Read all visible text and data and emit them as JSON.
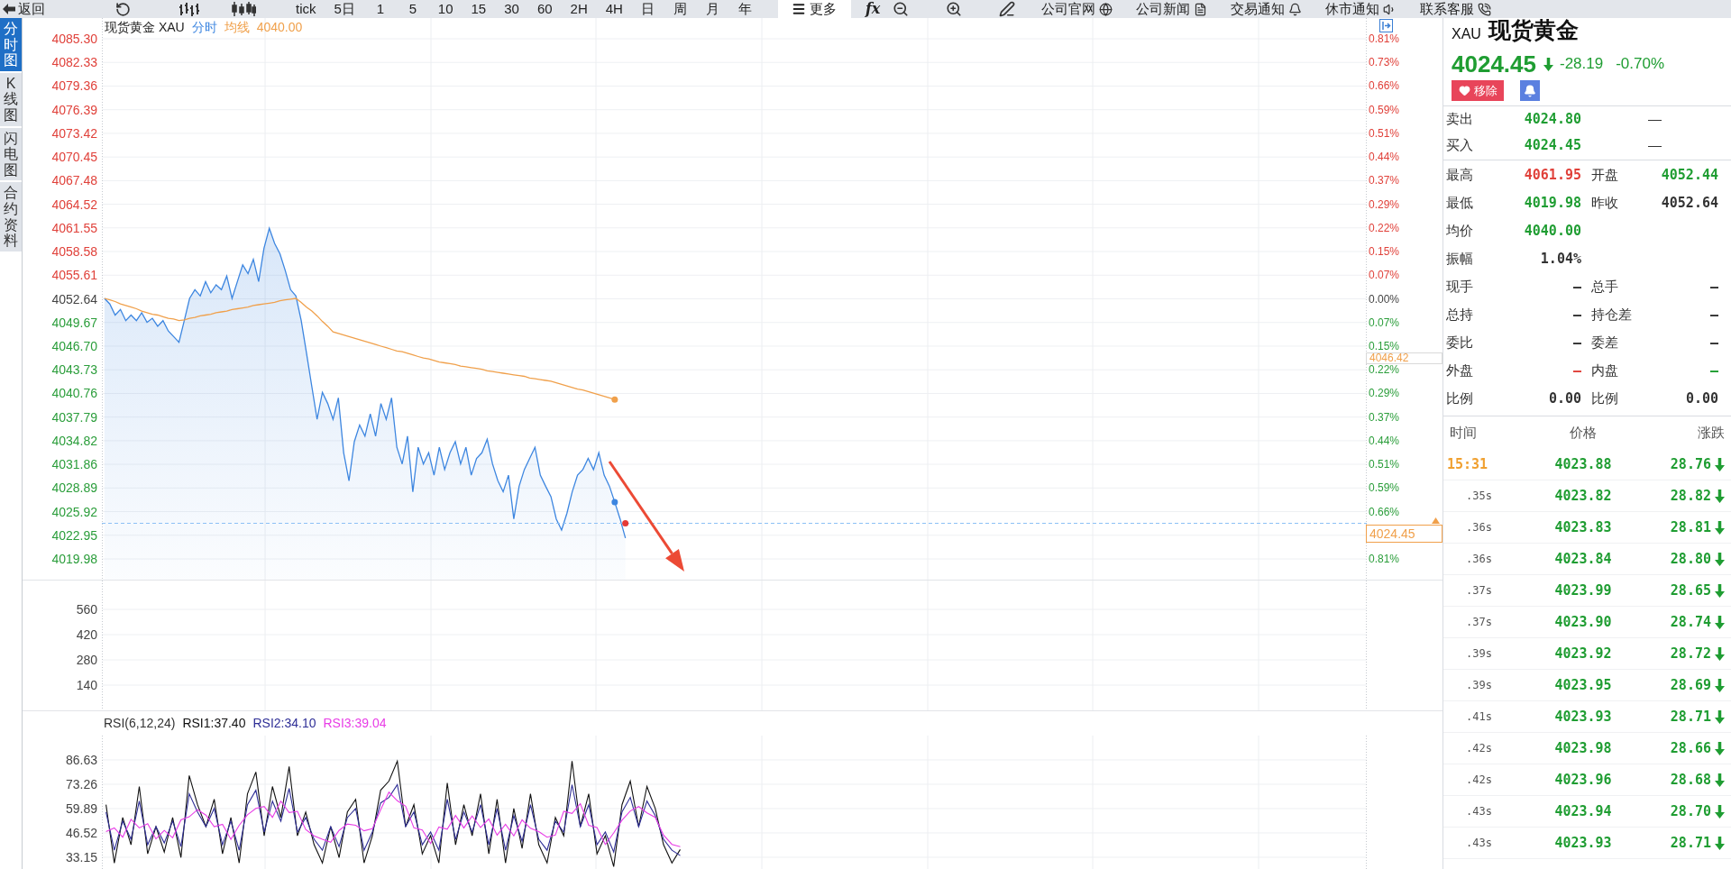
{
  "toolbar": {
    "back": "返回",
    "periods": [
      "tick",
      "5日",
      "1",
      "5",
      "10",
      "15",
      "30",
      "60",
      "2H",
      "4H",
      "日",
      "周",
      "月",
      "年"
    ],
    "more": "更多",
    "formula": "fx",
    "links": [
      "公司官网",
      "公司新闻",
      "交易通知",
      "休市通知",
      "联系客服"
    ]
  },
  "view_tabs": [
    {
      "label": "分时图",
      "selected": true
    },
    {
      "label": "K线图",
      "selected": false
    },
    {
      "label": "闪电图",
      "selected": false
    },
    {
      "label": "合约资料",
      "selected": false
    }
  ],
  "price_chart": {
    "title": "现货黄金 XAU",
    "legend_value": "4040.00",
    "chart_data": {
      "type": "line",
      "grid": true,
      "ylim": [
        4019.98,
        4085.3
      ],
      "yticks": [
        {
          "value": 4085.3,
          "label": "4085.30"
        },
        {
          "value": 4082.33,
          "label": "4082.33"
        },
        {
          "value": 4079.36,
          "label": "4079.36"
        },
        {
          "value": 4076.39,
          "label": "4076.39"
        },
        {
          "value": 4073.42,
          "label": "4073.42"
        },
        {
          "value": 4070.45,
          "label": "4070.45"
        },
        {
          "value": 4067.48,
          "label": "4067.48"
        },
        {
          "value": 4064.52,
          "label": "4064.52"
        },
        {
          "value": 4061.55,
          "label": "4061.55"
        },
        {
          "value": 4058.58,
          "label": "4058.58"
        },
        {
          "value": 4055.61,
          "label": "4055.61"
        },
        {
          "value": 4052.64,
          "label": "4052.64"
        },
        {
          "value": 4049.67,
          "label": "4049.67"
        },
        {
          "value": 4046.7,
          "label": "4046.70"
        },
        {
          "value": 4043.73,
          "label": "4043.73"
        },
        {
          "value": 4040.76,
          "label": "4040.76"
        },
        {
          "value": 4037.79,
          "label": "4037.79"
        },
        {
          "value": 4034.82,
          "label": "4034.82"
        },
        {
          "value": 4031.86,
          "label": "4031.86"
        },
        {
          "value": 4028.89,
          "label": "4028.89"
        },
        {
          "value": 4025.92,
          "label": "4025.92"
        },
        {
          "value": 4022.95,
          "label": "4022.95"
        },
        {
          "value": 4019.98,
          "label": "4019.98"
        }
      ],
      "series": [
        {
          "name": "分时",
          "color": "#3d86e0",
          "values": [
            4052.7,
            4052.0,
            4050.6,
            4051.3,
            4049.9,
            4050.6,
            4049.9,
            4050.9,
            4049.7,
            4050.2,
            4049.2,
            4049.9,
            4048.6,
            4047.9,
            4047.2,
            4049.9,
            4052.7,
            4053.8,
            4053.0,
            4054.8,
            4053.4,
            4054.4,
            4053.8,
            4055.5,
            4052.7,
            4054.8,
            4056.9,
            4055.8,
            4057.6,
            4054.8,
            4059.0,
            4061.5,
            4059.6,
            4058.3,
            4056.2,
            4053.8,
            4053.0,
            4049.9,
            4045.8,
            4041.6,
            4037.5,
            4040.9,
            4039.5,
            4037.5,
            4040.2,
            4033.3,
            4029.8,
            4034.7,
            4036.8,
            4035.4,
            4038.2,
            4035.4,
            4039.5,
            4037.5,
            4040.2,
            4034.0,
            4031.9,
            4035.4,
            4028.4,
            4034.0,
            4031.9,
            4033.3,
            4030.5,
            4034.0,
            4031.2,
            4033.3,
            4034.7,
            4031.9,
            4034.0,
            4030.5,
            4032.6,
            4033.3,
            4035.0,
            4031.9,
            4029.8,
            4028.4,
            4030.5,
            4025.0,
            4029.1,
            4031.2,
            4032.6,
            4034.0,
            4030.5,
            4029.1,
            4027.8,
            4025.0,
            4023.6,
            4025.7,
            4028.4,
            4030.5,
            4031.2,
            4032.6,
            4031.2,
            4033.3,
            4030.5,
            4029.1,
            4027.1,
            4025.0,
            4022.6,
            null,
            null,
            null,
            null,
            null,
            null,
            null,
            null,
            null,
            null,
            null,
            null,
            null,
            null,
            null,
            null,
            null,
            null,
            null,
            null,
            null,
            null,
            null,
            null,
            null,
            null,
            null,
            null,
            null,
            null,
            null,
            null,
            null,
            null,
            null,
            null,
            null,
            null,
            null,
            null,
            null,
            null,
            null,
            null,
            null,
            null,
            null,
            null,
            null,
            null,
            null,
            null,
            null,
            null,
            null,
            null,
            null,
            null,
            null,
            null,
            null,
            null,
            null,
            null,
            null,
            null,
            null,
            null,
            null,
            null,
            null,
            null,
            null,
            null,
            null,
            null,
            null,
            null,
            null,
            null,
            null,
            null,
            null,
            null,
            null,
            null,
            null,
            null,
            null,
            null,
            null,
            null,
            null,
            null,
            null,
            null,
            null,
            null,
            null,
            null,
            null,
            null,
            null,
            null,
            null,
            null,
            null,
            null,
            null,
            null,
            null,
            null,
            null,
            null,
            null,
            null,
            null,
            null,
            null,
            null,
            null,
            null,
            null,
            null,
            null,
            null,
            null,
            null,
            null,
            null,
            null,
            null,
            null,
            null,
            null,
            null,
            null,
            null,
            null
          ]
        },
        {
          "name": "均线",
          "color": "#f0a04b",
          "values": [
            4052.7,
            4052.5,
            4052.3,
            4052.0,
            4051.8,
            4051.6,
            4051.4,
            4051.1,
            4050.9,
            4050.7,
            4050.6,
            4050.4,
            4050.2,
            4050.1,
            4049.9,
            4050.0,
            4050.2,
            4050.3,
            4050.5,
            4050.6,
            4050.7,
            4050.9,
            4051.0,
            4051.1,
            4051.3,
            4051.4,
            4051.5,
            4051.6,
            4051.8,
            4051.9,
            4052.0,
            4052.1,
            4052.2,
            4052.4,
            4052.5,
            4052.6,
            4052.7,
            4052.2,
            4051.6,
            4051.1,
            4050.5,
            4049.8,
            4049.2,
            4048.5,
            4048.3,
            4048.1,
            4047.9,
            4047.7,
            4047.5,
            4047.3,
            4047.1,
            4046.9,
            4046.7,
            4046.5,
            4046.3,
            4046.1,
            4046.0,
            4045.8,
            4045.6,
            4045.4,
            4045.2,
            4045.1,
            4044.9,
            4044.7,
            4044.6,
            4044.5,
            4044.4,
            4044.2,
            4044.1,
            4044.0,
            4043.9,
            4043.8,
            4043.6,
            4043.5,
            4043.4,
            4043.3,
            4043.2,
            4043.1,
            4043.0,
            4042.9,
            4042.7,
            4042.6,
            4042.5,
            4042.4,
            4042.3,
            4042.1,
            4041.9,
            4041.7,
            4041.5,
            4041.3,
            4041.2,
            4041.0,
            4040.8,
            4040.6,
            4040.4,
            4040.2,
            4040.0,
            null,
            null,
            null,
            null,
            null,
            null,
            null,
            null,
            null,
            null,
            null,
            null,
            null,
            null,
            null,
            null,
            null,
            null,
            null,
            null,
            null,
            null,
            null,
            null,
            null,
            null,
            null,
            null,
            null,
            null,
            null,
            null,
            null,
            null,
            null,
            null,
            null,
            null,
            null,
            null,
            null,
            null,
            null,
            null,
            null,
            null,
            null,
            null,
            null,
            null,
            null,
            null,
            null,
            null,
            null,
            null,
            null,
            null,
            null,
            null,
            null,
            null,
            null,
            null,
            null,
            null,
            null,
            null,
            null,
            null,
            null,
            null,
            null,
            null,
            null,
            null,
            null,
            null,
            null,
            null,
            null,
            null,
            null,
            null,
            null,
            null,
            null,
            null,
            null,
            null,
            null,
            null,
            null,
            null,
            null,
            null,
            null,
            null,
            null,
            null,
            null,
            null,
            null,
            null,
            null,
            null,
            null,
            null,
            null,
            null,
            null,
            null,
            null,
            null,
            null,
            null,
            null,
            null,
            null,
            null,
            null,
            null,
            null,
            null,
            null,
            null,
            null,
            null,
            null,
            null,
            null,
            null,
            null,
            null,
            null,
            null,
            null,
            null,
            null,
            null,
            null
          ]
        }
      ],
      "ref_lines": [
        {
          "axis": "y",
          "value": 4024.45,
          "label": "4024.45",
          "color": "#8cc0f5"
        }
      ],
      "annotations": [
        "4046.42"
      ]
    },
    "tick_styles": [
      {
        "color": "#e0413a"
      },
      {
        "color": "#e0413a"
      },
      {
        "color": "#e0413a"
      },
      {
        "color": "#e0413a"
      },
      {
        "color": "#e0413a"
      },
      {
        "color": "#e0413a"
      },
      {
        "color": "#e0413a"
      },
      {
        "color": "#e0413a"
      },
      {
        "color": "#e0413a"
      },
      {
        "color": "#e0413a"
      },
      {
        "color": "#e0413a"
      },
      {
        "color": "#444444"
      },
      {
        "color": "#2a9d3a"
      },
      {
        "color": "#2a9d3a"
      },
      {
        "color": "#2a9d3a"
      },
      {
        "color": "#2a9d3a"
      },
      {
        "color": "#2a9d3a"
      },
      {
        "color": "#2a9d3a"
      },
      {
        "color": "#2a9d3a"
      },
      {
        "color": "#2a9d3a"
      },
      {
        "color": "#2a9d3a"
      },
      {
        "color": "#2a9d3a"
      },
      {
        "color": "#2a9d3a"
      }
    ],
    "right_axis": {
      "above_tag": [
        {
          "label": "0.81%",
          "color": "#e0413a"
        },
        {
          "label": "0.73%",
          "color": "#e0413a"
        },
        {
          "label": "0.66%",
          "color": "#e0413a"
        },
        {
          "label": "0.59%",
          "color": "#e0413a"
        },
        {
          "label": "0.51%",
          "color": "#e0413a"
        },
        {
          "label": "0.44%",
          "color": "#e0413a"
        },
        {
          "label": "0.37%",
          "color": "#e0413a"
        },
        {
          "label": "0.29%",
          "color": "#e0413a"
        },
        {
          "label": "0.22%",
          "color": "#e0413a"
        },
        {
          "label": "0.15%",
          "color": "#e0413a"
        },
        {
          "label": "0.07%",
          "color": "#e0413a"
        },
        {
          "label": "0.00%",
          "color": "#444444"
        },
        {
          "label": "0.07%",
          "color": "#2a9d3a"
        },
        {
          "label": "0.15%",
          "color": "#2a9d3a"
        },
        {
          "label": "0.22%",
          "color": "#2a9d3a"
        },
        {
          "label": "0.29%",
          "color": "#2a9d3a"
        },
        {
          "label": "0.37%",
          "color": "#2a9d3a"
        },
        {
          "label": "0.44%",
          "color": "#2a9d3a"
        },
        {
          "label": "0.51%",
          "color": "#2a9d3a"
        },
        {
          "label": "0.59%",
          "color": "#2a9d3a"
        },
        {
          "label": "0.66%",
          "color": "#2a9d3a"
        }
      ],
      "below_tag": [
        {
          "label": "0.81%",
          "color": "#2a9d3a"
        }
      ]
    }
  },
  "volume_chart": {
    "axis_labels": [
      "560",
      "420",
      "280",
      "140"
    ]
  },
  "rsi_chart": {
    "title": "RSI(6,12,24)",
    "chart_data": {
      "type": "line",
      "grid": true,
      "ylim": [
        26.7,
        100
      ],
      "yticks": [
        {
          "value": 86.63,
          "label": "86.63"
        },
        {
          "value": 73.26,
          "label": "73.26"
        },
        {
          "value": 59.89,
          "label": "59.89"
        },
        {
          "value": 46.52,
          "label": "46.52"
        },
        {
          "value": 33.15,
          "label": "33.15"
        }
      ],
      "series": [
        {
          "name": "RSI1:37.40",
          "color": "#111111",
          "values": [
            62,
            30,
            55,
            40,
            72,
            35,
            50,
            36,
            55,
            33,
            78,
            62,
            50,
            65,
            35,
            55,
            30,
            68,
            80,
            45,
            72,
            55,
            83,
            45,
            58,
            40,
            30,
            50,
            33,
            58,
            65,
            30,
            45,
            70,
            75,
            86,
            50,
            62,
            35,
            45,
            30,
            74,
            40,
            62,
            45,
            68,
            35,
            65,
            30,
            60,
            38,
            68,
            40,
            30,
            55,
            45,
            86,
            50,
            68,
            35,
            45,
            28,
            62,
            75,
            50,
            72,
            60,
            40,
            30,
            37.4,
            null,
            null,
            null,
            null,
            null,
            null,
            null,
            null,
            null,
            null,
            null,
            null,
            null,
            null,
            null,
            null,
            null,
            null,
            null,
            null,
            null,
            null,
            null,
            null,
            null,
            null,
            null,
            null,
            null,
            null,
            null,
            null,
            null,
            null,
            null,
            null,
            null,
            null,
            null,
            null,
            null,
            null,
            null,
            null,
            null,
            null,
            null,
            null,
            null,
            null,
            null,
            null,
            null,
            null,
            null,
            null,
            null,
            null,
            null,
            null,
            null,
            null,
            null,
            null,
            null,
            null,
            null,
            null,
            null,
            null,
            null,
            null,
            null,
            null,
            null,
            null,
            null,
            null,
            null,
            null,
            null,
            null
          ]
        },
        {
          "name": "RSI2:34.10",
          "color": "#2e2e96",
          "values": [
            58,
            37,
            53,
            43,
            64,
            40,
            50,
            41,
            53,
            39,
            68,
            58,
            50,
            60,
            40,
            53,
            37,
            62,
            70,
            47,
            64,
            53,
            71,
            47,
            55,
            43,
            37,
            50,
            39,
            55,
            60,
            37,
            47,
            63,
            66,
            73,
            50,
            58,
            40,
            47,
            37,
            65,
            43,
            58,
            47,
            62,
            40,
            60,
            37,
            56,
            42,
            62,
            43,
            37,
            53,
            47,
            73,
            50,
            62,
            40,
            47,
            36,
            58,
            66,
            50,
            64,
            56,
            43,
            37,
            34.1,
            null,
            null,
            null,
            null,
            null,
            null,
            null,
            null,
            null,
            null,
            null,
            null,
            null,
            null,
            null,
            null,
            null,
            null,
            null,
            null,
            null,
            null,
            null,
            null,
            null,
            null,
            null,
            null,
            null,
            null,
            null,
            null,
            null,
            null,
            null,
            null,
            null,
            null,
            null,
            null,
            null,
            null,
            null,
            null,
            null,
            null,
            null,
            null,
            null,
            null,
            null,
            null,
            null,
            null,
            null,
            null,
            null,
            null,
            null,
            null,
            null,
            null,
            null,
            null,
            null,
            null,
            null,
            null,
            null,
            null,
            null,
            null,
            null,
            null,
            null,
            null,
            null,
            null,
            null,
            null,
            null,
            null
          ]
        },
        {
          "name": "RSI3:39.04",
          "color": "#e83de6",
          "values": [
            47.2,
            49.3,
            44.2,
            54,
            49.3,
            51.6,
            43.2,
            47.9,
            43.9,
            53.7,
            55.4,
            59.3,
            56.3,
            50,
            51.2,
            43,
            50.7,
            56.5,
            60,
            61,
            55.1,
            64,
            57.7,
            58.4,
            48.4,
            44.9,
            43,
            41.4,
            47.9,
            51.4,
            50.7,
            47.7,
            48.8,
            59.3,
            68.9,
            64.2,
            61.2,
            49.3,
            48.1,
            40.7,
            49.8,
            48.6,
            56.1,
            49.3,
            55.8,
            49.5,
            54.2,
            45.3,
            51.2,
            44.9,
            53.7,
            49.1,
            47.2,
            44.2,
            45.3,
            58.4,
            57.2,
            62.6,
            50.7,
            49.5,
            40.2,
            46.5,
            53.5,
            58.6,
            61,
            57.5,
            55.1,
            45.3,
            40.2,
            39,
            null,
            null,
            null,
            null,
            null,
            null,
            null,
            null,
            null,
            null,
            null,
            null,
            null,
            null,
            null,
            null,
            null,
            null,
            null,
            null,
            null,
            null,
            null,
            null,
            null,
            null,
            null,
            null,
            null,
            null,
            null,
            null,
            null,
            null,
            null,
            null,
            null,
            null,
            null,
            null,
            null,
            null,
            null,
            null,
            null,
            null,
            null,
            null,
            null,
            null,
            null,
            null,
            null,
            null,
            null,
            null,
            null,
            null,
            null,
            null,
            null,
            null,
            null,
            null,
            null,
            null,
            null,
            null,
            null,
            null,
            null,
            null,
            null,
            null,
            null,
            null,
            null,
            null,
            null,
            null,
            null,
            null
          ]
        }
      ]
    }
  },
  "quote": {
    "code": "XAU",
    "name": "现货黄金",
    "price": "4024.45",
    "falling": true,
    "change": "-28.19",
    "change_percent": "-0.70%",
    "remove_label": "移除"
  },
  "order_book": [
    {
      "label": "卖出",
      "value": "4024.80",
      "color": "#1f9d32",
      "extra": "—"
    },
    {
      "label": "买入",
      "value": "4024.45",
      "color": "#1f9d32",
      "extra": "—"
    }
  ],
  "stats": [
    {
      "cells": [
        {
          "label": "最高",
          "value": "4061.95",
          "color": "#e0413a"
        },
        {
          "label": "开盘",
          "value": "4052.44",
          "color": "#1f9d32"
        }
      ]
    },
    {
      "cells": [
        {
          "label": "最低",
          "value": "4019.98",
          "color": "#1f9d32"
        },
        {
          "label": "昨收",
          "value": "4052.64",
          "color": "#333333"
        }
      ]
    },
    {
      "cells": [
        {
          "label": "均价",
          "value": "4040.00",
          "color": "#1f9d32"
        }
      ]
    },
    {
      "cells": [
        {
          "label": "振幅",
          "value": "1.04%",
          "color": "#333333"
        }
      ]
    },
    {
      "cells": [
        {
          "label": "现手",
          "value": "—",
          "color": "#333333"
        },
        {
          "label": "总手",
          "value": "—",
          "color": "#333333"
        }
      ]
    },
    {
      "cells": [
        {
          "label": "总持",
          "value": "—",
          "color": "#333333"
        },
        {
          "label": "持仓差",
          "value": "—",
          "color": "#333333"
        }
      ]
    },
    {
      "cells": [
        {
          "label": "委比",
          "value": "—",
          "color": "#333333"
        },
        {
          "label": "委差",
          "value": "—",
          "color": "#333333"
        }
      ]
    },
    {
      "cells": [
        {
          "label": "外盘",
          "value": "—",
          "color": "#e0413a"
        },
        {
          "label": "内盘",
          "value": "—",
          "color": "#1f9d32"
        }
      ]
    },
    {
      "cells": [
        {
          "label": "比例",
          "value": "0.00",
          "color": "#333333"
        },
        {
          "label": "比例",
          "value": "0.00",
          "color": "#333333"
        }
      ]
    }
  ],
  "trades": {
    "columns": [
      "时间",
      "价格",
      "涨跌"
    ],
    "rows": [
      {
        "time": "15:31",
        "kind": "minute",
        "price": "4023.88",
        "change": "28.76",
        "falling": true
      },
      {
        "time": ".35s",
        "kind": "second",
        "price": "4023.82",
        "change": "28.82",
        "falling": true
      },
      {
        "time": ".36s",
        "kind": "second",
        "price": "4023.83",
        "change": "28.81",
        "falling": true
      },
      {
        "time": ".36s",
        "kind": "second",
        "price": "4023.84",
        "change": "28.80",
        "falling": true
      },
      {
        "time": ".37s",
        "kind": "second",
        "price": "4023.99",
        "change": "28.65",
        "falling": true
      },
      {
        "time": ".37s",
        "kind": "second",
        "price": "4023.90",
        "change": "28.74",
        "falling": true
      },
      {
        "time": ".39s",
        "kind": "second",
        "price": "4023.92",
        "change": "28.72",
        "falling": true
      },
      {
        "time": ".39s",
        "kind": "second",
        "price": "4023.95",
        "change": "28.69",
        "falling": true
      },
      {
        "time": ".41s",
        "kind": "second",
        "price": "4023.93",
        "change": "28.71",
        "falling": true
      },
      {
        "time": ".42s",
        "kind": "second",
        "price": "4023.98",
        "change": "28.66",
        "falling": true
      },
      {
        "time": ".42s",
        "kind": "second",
        "price": "4023.96",
        "change": "28.68",
        "falling": true
      },
      {
        "time": ".43s",
        "kind": "second",
        "price": "4023.94",
        "change": "28.70",
        "falling": true
      },
      {
        "time": ".43s",
        "kind": "second",
        "price": "4023.93",
        "change": "28.71",
        "falling": true
      }
    ]
  }
}
